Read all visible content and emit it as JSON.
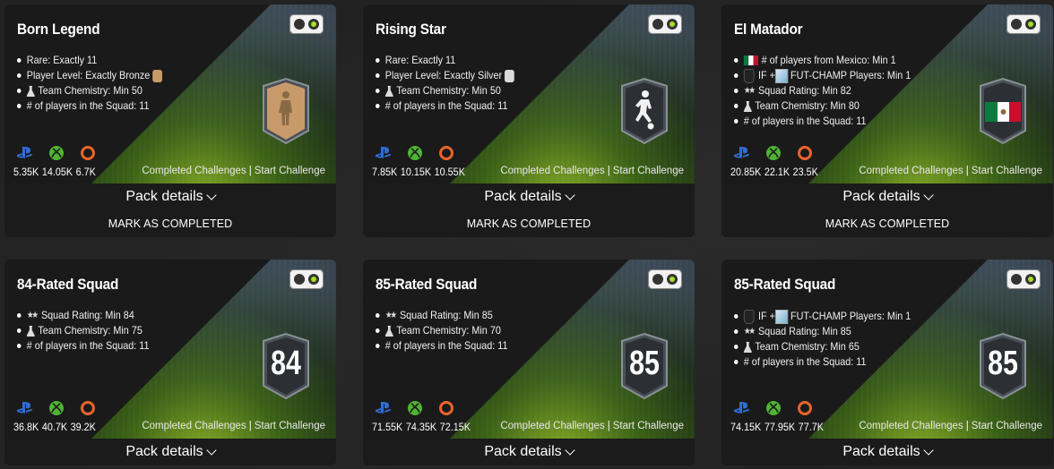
{
  "cards": [
    {
      "title": "Born Legend",
      "requirements": [
        "Rare: Exactly 11",
        "Player Level: Exactly Bronze",
        "Team Chemistry: Min 50",
        "# of players in the Squad: 11"
      ],
      "counts": {
        "ps": "5.35K",
        "xbox": "14.05K",
        "pc": "6.7K"
      },
      "completed_label": "Completed Challenges",
      "start_label": "Start Challenge",
      "pack_label": "Pack details",
      "mark_label": "MARK AS COMPLETED",
      "badge_color": "#c89a6a"
    },
    {
      "title": "Rising Star",
      "requirements": [
        "Rare: Exactly 11",
        "Player Level: Exactly Silver",
        "Team Chemistry: Min 50",
        "# of players in the Squad: 11"
      ],
      "counts": {
        "ps": "7.85K",
        "xbox": "10.15K",
        "pc": "10.55K"
      },
      "completed_label": "Completed Challenges",
      "start_label": "Start Challenge",
      "pack_label": "Pack details",
      "mark_label": "MARK AS COMPLETED",
      "badge_color": "#d9d9d9"
    },
    {
      "title": "El Matador",
      "requirements": [
        "# of players from Mexico: Min 1",
        "IF + ",
        "FUT-CHAMP Players: Min 1",
        "Squad Rating: Min 82",
        "Team Chemistry: Min 80",
        "# of players in the Squad: 11"
      ],
      "counts": {
        "ps": "20.85K",
        "xbox": "22.1K",
        "pc": "23.5K"
      },
      "completed_label": "Completed Challenges",
      "start_label": "Start Challenge",
      "pack_label": "Pack details",
      "mark_label": "MARK AS COMPLETED"
    },
    {
      "title": "84-Rated Squad",
      "requirements": [
        "Squad Rating: Min 84",
        "Team Chemistry: Min 75",
        "# of players in the Squad: 11"
      ],
      "badge_number": "84",
      "counts": {
        "ps": "36.8K",
        "xbox": "40.7K",
        "pc": "39.2K"
      },
      "completed_label": "Completed Challenges",
      "start_label": "Start Challenge",
      "pack_label": "Pack details"
    },
    {
      "title": "85-Rated Squad",
      "requirements": [
        "Squad Rating: Min 85",
        "Team Chemistry: Min 70",
        "# of players in the Squad: 11"
      ],
      "badge_number": "85",
      "counts": {
        "ps": "71.55K",
        "xbox": "74.35K",
        "pc": "72.15K"
      },
      "completed_label": "Completed Challenges",
      "start_label": "Start Challenge",
      "pack_label": "Pack details"
    },
    {
      "title": "85-Rated Squad",
      "requirements": [
        "IF + ",
        "FUT-CHAMP Players: Min 1",
        "Squad Rating: Min 85",
        "Team Chemistry: Min 65",
        "# of players in the Squad: 11"
      ],
      "badge_number": "85",
      "counts": {
        "ps": "74.15K",
        "xbox": "77.95K",
        "pc": "77.7K"
      },
      "completed_label": "Completed Challenges",
      "start_label": "Start Challenge",
      "pack_label": "Pack details"
    }
  ],
  "colors": {
    "accent_green": "#a6e02a",
    "playstation": "#2f6ed8",
    "xbox": "#4fb433",
    "origin": "#e8642c",
    "mexico_green": "#0b7a3e",
    "mexico_red": "#c8102e"
  }
}
